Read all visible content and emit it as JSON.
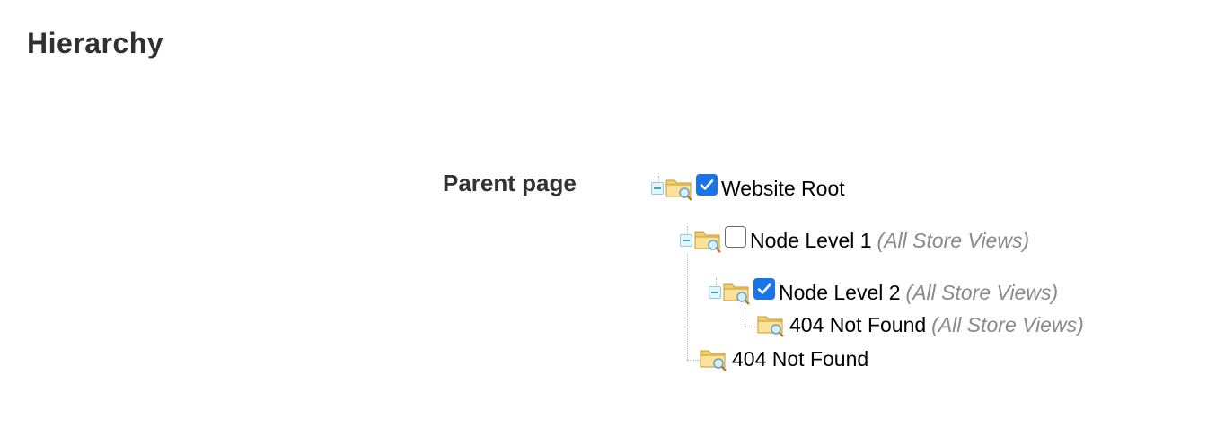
{
  "section": {
    "title": "Hierarchy"
  },
  "field": {
    "label": "Parent page"
  },
  "tree": {
    "nodes": [
      {
        "label": "Website Root",
        "store": "",
        "checked": true
      },
      {
        "label": "Node Level 1",
        "store": "(All Store Views)",
        "checked": false
      },
      {
        "label": "Node Level 2",
        "store": "(All Store Views)",
        "checked": true
      },
      {
        "label": "404 Not Found",
        "store": "(All Store Views)"
      },
      {
        "label": "404 Not Found",
        "store": ""
      }
    ]
  },
  "colors": {
    "checkbox_checked": "#1a73e8",
    "store_view_text": "#8a8a8a",
    "toggle_border": "#8ccde0"
  },
  "icons": {
    "toggle": "collapse-minus-icon",
    "folder": "folder-search-icon",
    "checkbox": "checkmark-icon"
  }
}
